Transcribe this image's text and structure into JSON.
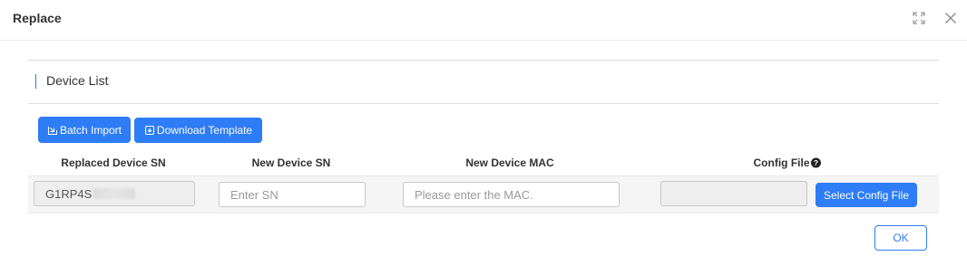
{
  "dialog": {
    "title": "Replace",
    "maximize_icon": "maximize-icon",
    "close_icon": "close-icon"
  },
  "section": {
    "title": "Device List"
  },
  "toolbar": {
    "batch_import_label": "Batch Import",
    "batch_import_icon": "import-icon",
    "download_template_label": "Download Template",
    "download_template_icon": "download-icon"
  },
  "table": {
    "columns": [
      "Replaced Device SN",
      "New Device SN",
      "New Device MAC",
      "Config File"
    ],
    "config_help_icon": "help-icon",
    "rows": [
      {
        "replaced_sn": "G1RP4S",
        "new_sn_value": "",
        "new_sn_placeholder": "Enter SN",
        "mac_value": "",
        "mac_placeholder": "Please enter the MAC.",
        "config_file": "",
        "select_config_label": "Select Config File"
      }
    ]
  },
  "footer": {
    "ok_label": "OK"
  },
  "colors": {
    "primary": "#2e7cf6",
    "accent_bar": "#2f7de1"
  }
}
